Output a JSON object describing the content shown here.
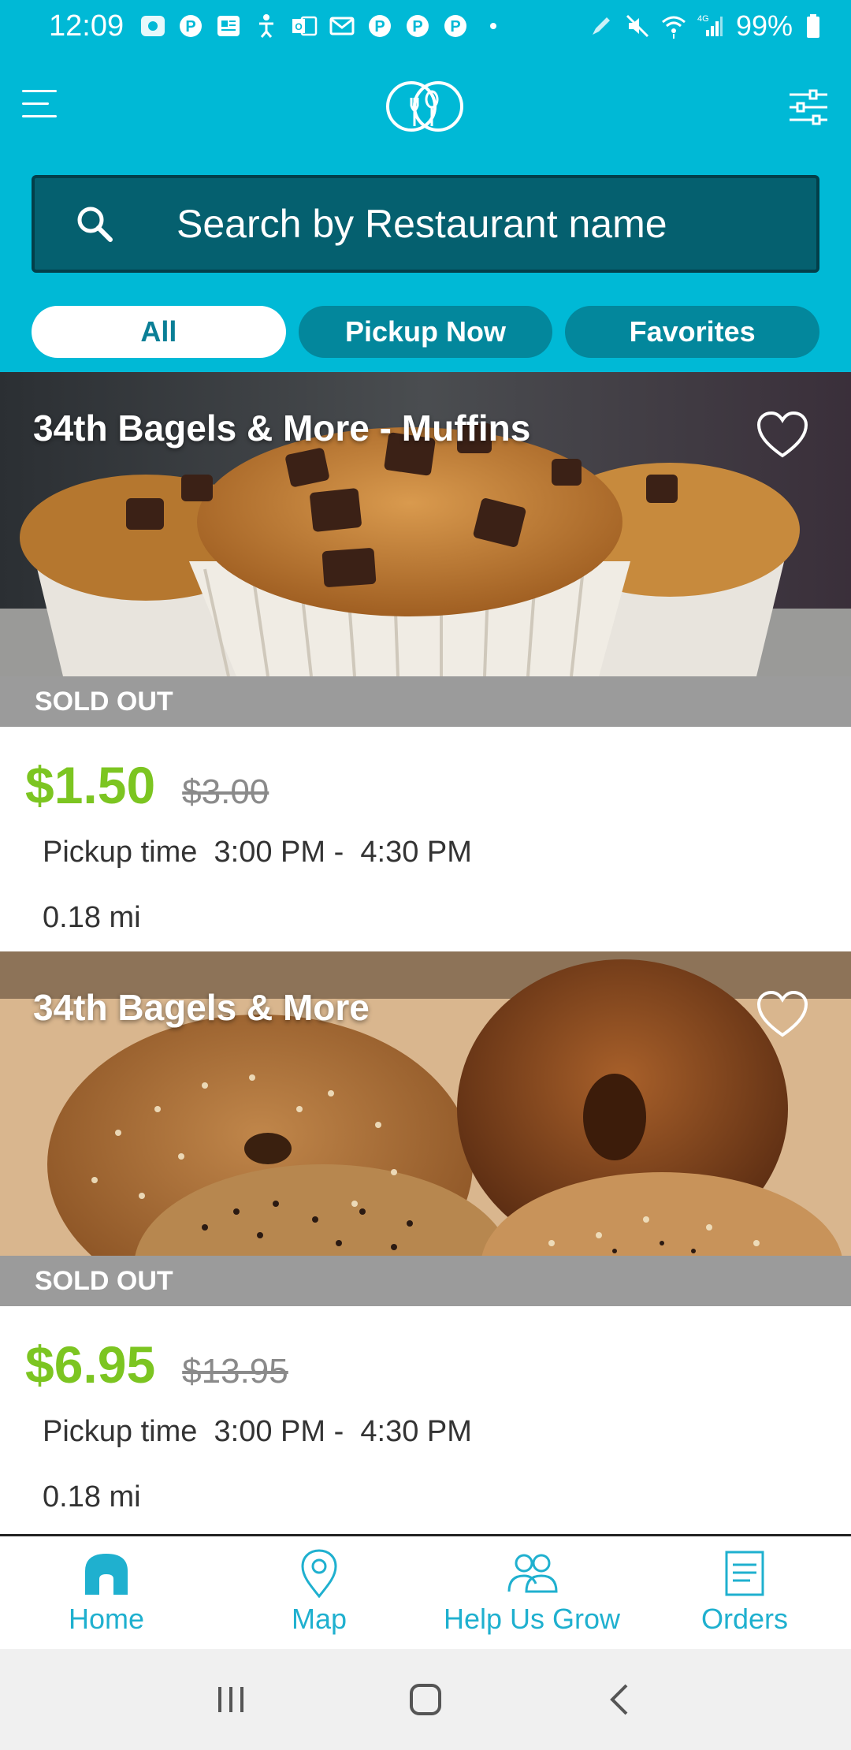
{
  "status_bar": {
    "time": "12:09",
    "battery": "99%",
    "network": "4G"
  },
  "header": {
    "search_placeholder": "Search by Restaurant name",
    "tabs": [
      {
        "label": "All",
        "active": true
      },
      {
        "label": "Pickup Now",
        "active": false
      },
      {
        "label": "Favorites",
        "active": false
      }
    ]
  },
  "listings": [
    {
      "name": "34th Bagels & More - Muffins",
      "status": "SOLD OUT",
      "price": "$1.50",
      "original_price": "$3.00",
      "pickup_label": "Pickup time",
      "pickup_window": "3:00 PM -  4:30 PM",
      "distance": "0.18 mi",
      "image": "chocolate-chip-muffins"
    },
    {
      "name": "34th Bagels & More",
      "status": "SOLD OUT",
      "price": "$6.95",
      "original_price": "$13.95",
      "pickup_label": "Pickup time",
      "pickup_window": "3:00 PM -  4:30 PM",
      "distance": "0.18 mi",
      "image": "assorted-bagels"
    }
  ],
  "bottom_nav": [
    {
      "label": "Home",
      "icon": "home-icon"
    },
    {
      "label": "Map",
      "icon": "map-pin-icon"
    },
    {
      "label": "Help Us Grow",
      "icon": "people-icon"
    },
    {
      "label": "Orders",
      "icon": "receipt-icon"
    }
  ],
  "colors": {
    "brand_teal": "#00b9d6",
    "search_bg": "#05606f",
    "price_green": "#7cc521",
    "sold_out_gray": "#9b9b9b",
    "nav_accent": "#1fb0cf"
  }
}
